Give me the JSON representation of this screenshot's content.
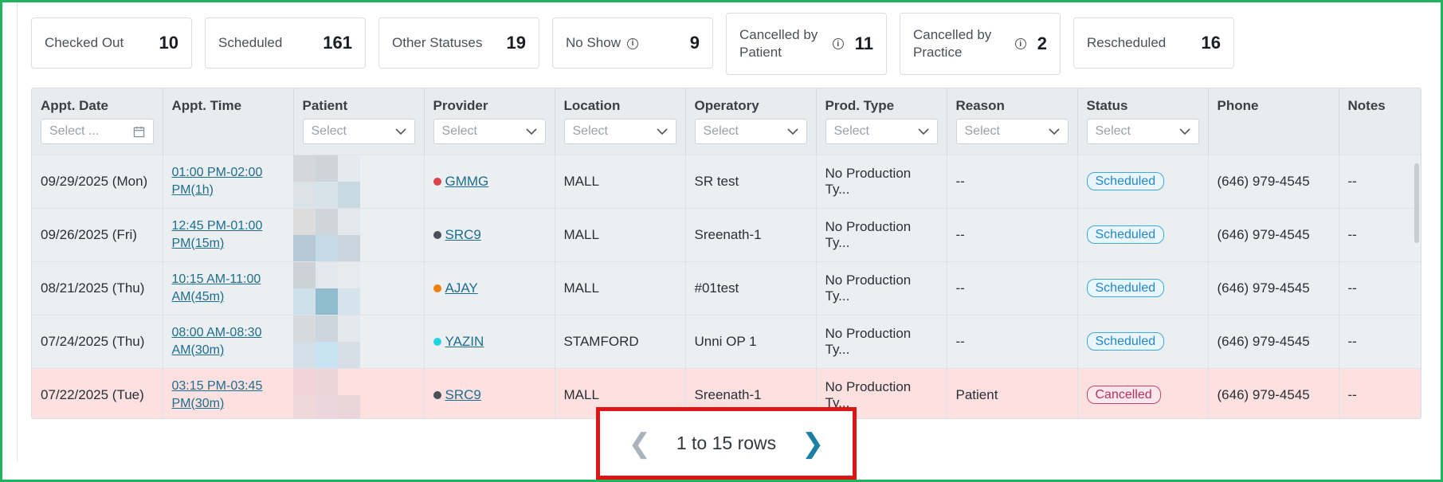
{
  "stats": [
    {
      "label": "Checked Out",
      "value": "10",
      "info": false
    },
    {
      "label": "Scheduled",
      "value": "161",
      "info": false
    },
    {
      "label": "Other Statuses",
      "value": "19",
      "info": false
    },
    {
      "label": "No Show",
      "value": "9",
      "info": true
    },
    {
      "label": "Cancelled by Patient",
      "value": "11",
      "info": true
    },
    {
      "label": "Cancelled by Practice",
      "value": "2",
      "info": true
    },
    {
      "label": "Rescheduled",
      "value": "16",
      "info": false
    }
  ],
  "table": {
    "columns": [
      "Appt. Date",
      "Appt. Time",
      "Patient",
      "Provider",
      "Location",
      "Operatory",
      "Prod. Type",
      "Reason",
      "Status",
      "Phone",
      "Notes"
    ],
    "date_filter_placeholder": "Select ...",
    "select_placeholder": "Select",
    "rows": [
      {
        "date": "09/29/2025 (Mon)",
        "time1": "01:00 PM-02:00",
        "time2": "PM(1h)",
        "provider": "GMMG",
        "provider_color": "#d9434a",
        "location": "MALL",
        "operatory": "SR test",
        "prod": "No Production Ty...",
        "reason": "--",
        "status": "Scheduled",
        "phone": "(646) 979-4545",
        "notes": "--"
      },
      {
        "date": "09/26/2025 (Fri)",
        "time1": "12:45 PM-01:00",
        "time2": "PM(15m)",
        "provider": "SRC9",
        "provider_color": "#4a4f57",
        "location": "MALL",
        "operatory": "Sreenath-1",
        "prod": "No Production Ty...",
        "reason": "--",
        "status": "Scheduled",
        "phone": "(646) 979-4545",
        "notes": "--"
      },
      {
        "date": "08/21/2025 (Thu)",
        "time1": "10:15 AM-11:00",
        "time2": "AM(45m)",
        "provider": "AJAY",
        "provider_color": "#f07f0f",
        "location": "MALL",
        "operatory": "#01test",
        "prod": "No Production Ty...",
        "reason": "--",
        "status": "Scheduled",
        "phone": "(646) 979-4545",
        "notes": "--"
      },
      {
        "date": "07/24/2025 (Thu)",
        "time1": "08:00 AM-08:30",
        "time2": "AM(30m)",
        "provider": "YAZIN",
        "provider_color": "#22d3e6",
        "location": "STAMFORD",
        "operatory": "Unni OP 1",
        "prod": "No Production Ty...",
        "reason": "--",
        "status": "Scheduled",
        "phone": "(646) 979-4545",
        "notes": "--"
      },
      {
        "date": "07/22/2025 (Tue)",
        "time1": "03:15 PM-03:45",
        "time2": "PM(30m)",
        "provider": "SRC9",
        "provider_color": "#4a4f57",
        "location": "MALL",
        "operatory": "Sreenath-1",
        "prod": "No Production Ty...",
        "reason": "Patient",
        "status": "Cancelled",
        "phone": "(646) 979-4545",
        "notes": "--"
      }
    ]
  },
  "pager": {
    "prev_icon": "chevron-left-icon",
    "next_icon": "chevron-right-icon",
    "label": "1 to 15 rows"
  },
  "colors": {
    "accent": "#1d7fa3",
    "frame": "#22b35e",
    "highlight": "#dd1515",
    "scheduled": "#2387c8",
    "cancelled": "#b73160"
  }
}
